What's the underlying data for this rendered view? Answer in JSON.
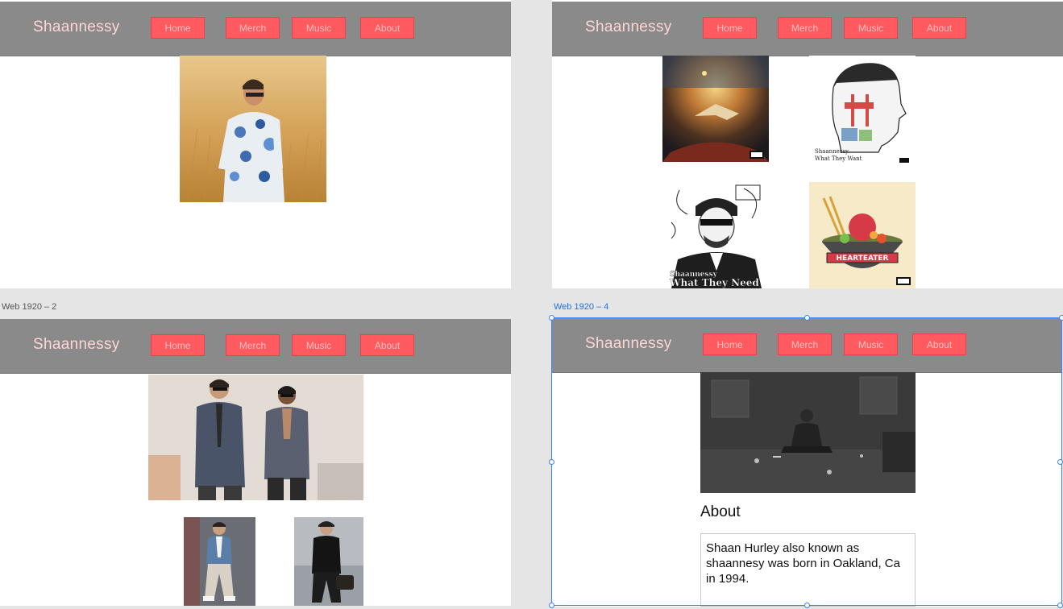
{
  "artboards": {
    "label_left": "Web 1920 – 2",
    "label_right": "Web 1920 – 4"
  },
  "nav": {
    "brand": "Shaannessy",
    "home": "Home",
    "merch": "Merch",
    "music": "Music",
    "about": "About"
  },
  "album_art": {
    "what_they_want_caption_line1": "Shaannessy",
    "what_they_want_caption_line2": "What They Want",
    "what_they_need_line1": "Shaannessy",
    "what_they_need_line2": "What They Need",
    "hearteater_title": "HEARTEATER",
    "advisory": "PARENTAL ADVISORY"
  },
  "about_page": {
    "heading": "About",
    "bio": "Shaan Hurley also known as shaannesy was born in Oakland, Ca in 1994."
  },
  "colors": {
    "navbar": "#8a8a8a",
    "nav_button": "#ff5a5f",
    "selection": "#3b82f6"
  }
}
